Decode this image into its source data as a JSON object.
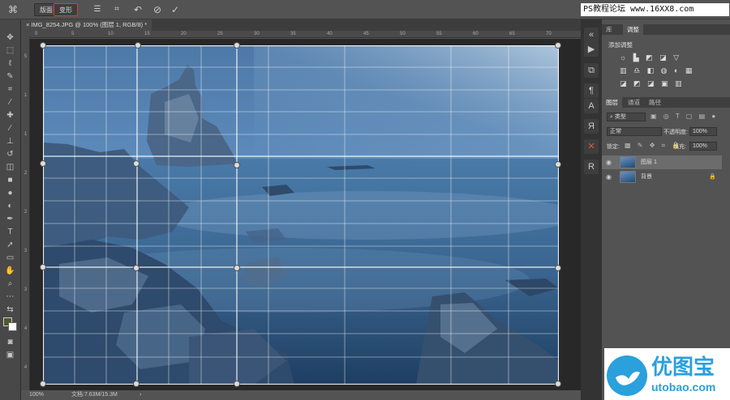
{
  "topbar": {
    "mode1_label": "版面",
    "mode2_label": "变形",
    "watermark_text": "PS教程论坛 www.16XX8.com"
  },
  "document": {
    "tab_title": "IMG_8254.JPG @ 100% (图层 1, RGB/8) *",
    "ruler_ticks": [
      "0",
      "5",
      "10",
      "15",
      "20",
      "25",
      "30",
      "35",
      "40",
      "45",
      "50",
      "55",
      "60",
      "65",
      "70"
    ],
    "vruler_ticks": [
      "5",
      "1",
      "1",
      "2",
      "2",
      "3",
      "3",
      "4",
      "4"
    ]
  },
  "status": {
    "zoom": "100%",
    "doc_size": "文档:7.63M/15.3M"
  },
  "panels": {
    "top_tabs": [
      "库",
      "调整"
    ],
    "add_adjustment_label": "添加调整",
    "layer_tabs": [
      "图层",
      "通道",
      "路径"
    ],
    "kind_filter": "类型",
    "blend_mode": "正常",
    "opacity_label": "不透明度:",
    "opacity_value": "100%",
    "lock_label": "锁定:",
    "fill_label": "填充:",
    "fill_value": "100%",
    "layers": [
      {
        "name": "图层 1",
        "selected": true
      },
      {
        "name": "背景",
        "selected": false
      }
    ]
  },
  "brand": {
    "logo_text": "优图宝",
    "logo_url_text": "utobao.com",
    "logo_color": "#2aa0dc"
  },
  "colors": {
    "accent_red": "#d9402a",
    "foreground_swatch": "#4a5b2a",
    "background_swatch": "#ffffff"
  }
}
